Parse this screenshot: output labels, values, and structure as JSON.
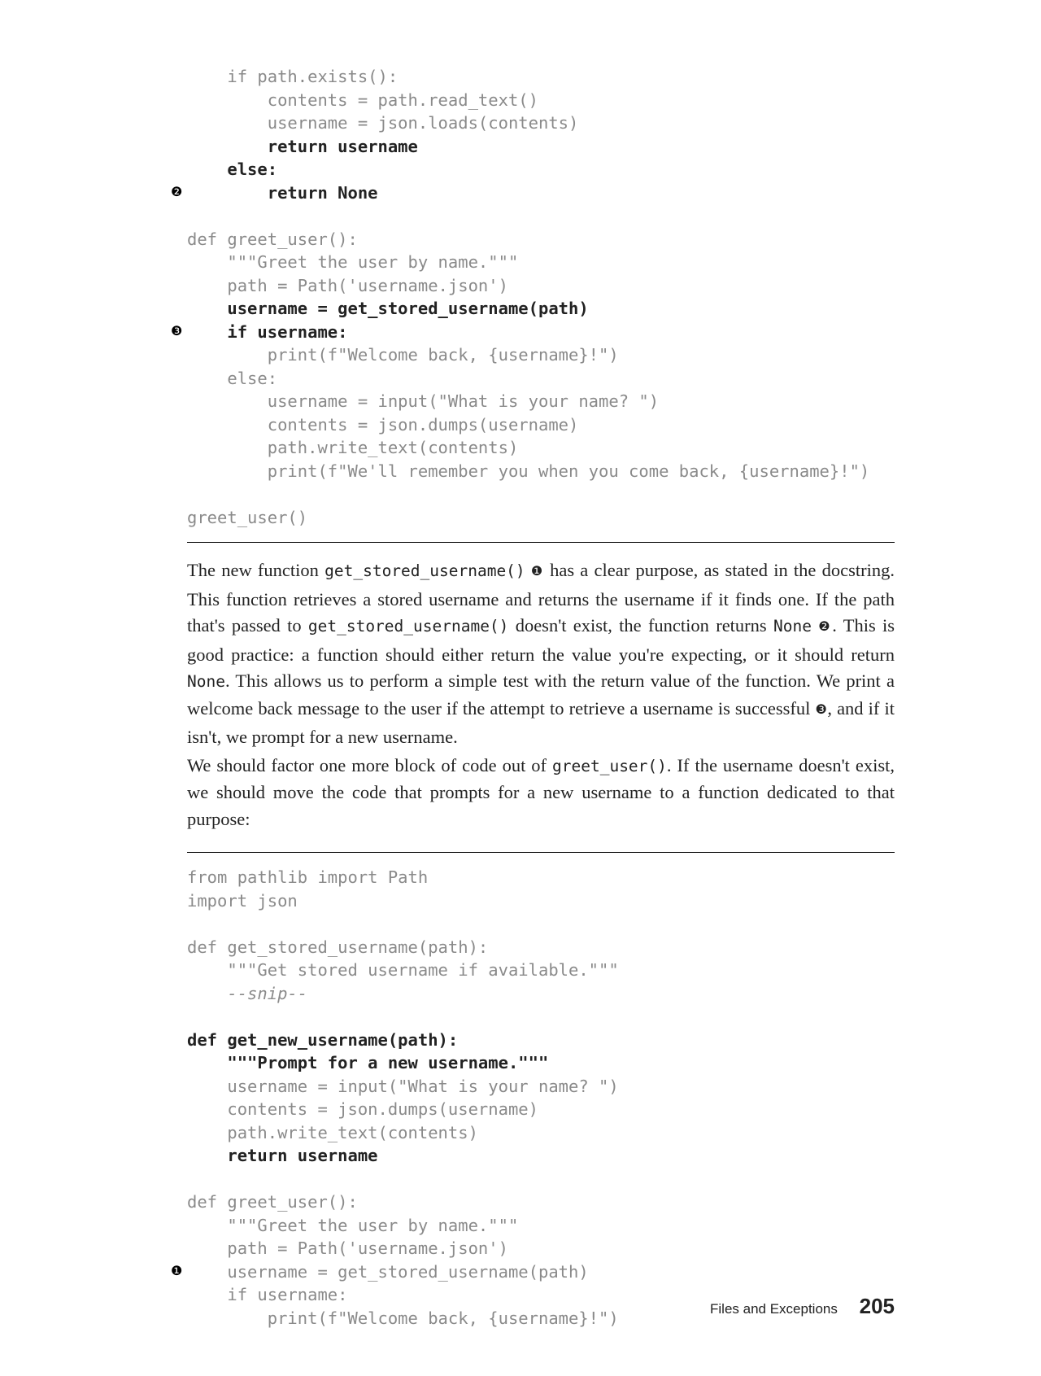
{
  "listing1": {
    "l1": "    if path.exists():",
    "l2": "        contents = path.read_text()",
    "l3": "        username = json.loads(contents)",
    "l4": "        return username",
    "l5": "    else:",
    "l6": "        return None",
    "l7": "def greet_user():",
    "l8": "    \"\"\"Greet the user by name.\"\"\"",
    "l9": "    path = Path('username.json')",
    "l10": "    username = get_stored_username(path)",
    "l11": "    if username:",
    "l12": "        print(f\"Welcome back, {username}!\")",
    "l13": "    else:",
    "l14": "        username = input(\"What is your name? \")",
    "l15": "        contents = json.dumps(username)",
    "l16": "        path.write_text(contents)",
    "l17": "        print(f\"We'll remember you when you come back, {username}!\")",
    "l18": "greet_user()",
    "sn2": "❷",
    "sn3": "❸"
  },
  "prose": {
    "p1a": "The new function ",
    "p1b": "get_stored_username()",
    "p1c": " ",
    "sn1": "❶",
    "p1d": " has a clear purpose, as stated in the docstring. This function retrieves a stored username and returns the username if it finds one. If the path that's passed to ",
    "p1e": "get_stored_username()",
    "p1f": " doesn't exist, the function returns ",
    "p1g": "None",
    "p1h": " ",
    "sn2": "❷",
    "p1i": ". This is good practice: a function should either return the value you're expecting, or it should return ",
    "p1j": "None",
    "p1k": ". This allows us to perform a simple test with the return value of the function. We print a welcome back message to the user if the attempt to retrieve a username is successful ",
    "sn3": "❸",
    "p1l": ", and if it isn't, we prompt for a new username.",
    "p2a": "We should factor one more block of code out of ",
    "p2b": "greet_user()",
    "p2c": ". If the username doesn't exist, we should move the code that prompts for a new username to a function dedicated to that purpose:"
  },
  "listing2": {
    "l1": "from pathlib import Path",
    "l2": "import json",
    "l3": "def get_stored_username(path):",
    "l4": "    \"\"\"Get stored username if available.\"\"\"",
    "l5_pre": "    ",
    "l5_i": "--snip--",
    "l6": "def get_new_username(path):",
    "l7": "    \"\"\"Prompt for a new username.\"\"\"",
    "l8": "    username = input(\"What is your name? \")",
    "l9": "    contents = json.dumps(username)",
    "l10": "    path.write_text(contents)",
    "l11": "    return username",
    "l12": "def greet_user():",
    "l13": "    \"\"\"Greet the user by name.\"\"\"",
    "l14": "    path = Path('username.json')",
    "l15": "    username = get_stored_username(path)",
    "l16": "    if username:",
    "l17": "        print(f\"Welcome back, {username}!\")",
    "sn1": "❶"
  },
  "footer": {
    "chapter": "Files and Exceptions",
    "page": "205"
  }
}
